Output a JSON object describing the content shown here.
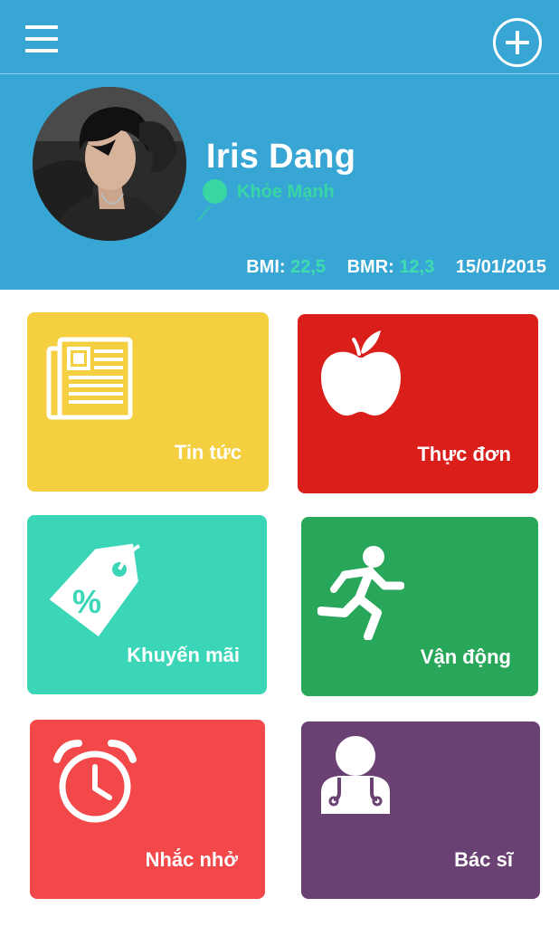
{
  "header": {
    "background_color": "#38a6d4",
    "menu_icon": "hamburger-menu-icon",
    "add_icon": "plus-circle-icon"
  },
  "profile": {
    "name": "Iris Dang",
    "status": "Khỏe Mạnh",
    "status_color": "#38d6a3",
    "avatar": "user-avatar-photo"
  },
  "stats": {
    "bmi_label": "BMI:",
    "bmi_value": "22,5",
    "bmr_label": "BMR:",
    "bmr_value": "12,3",
    "date": "15/01/2015",
    "value_color": "#3fdcae"
  },
  "tiles": [
    {
      "label": "Tin tức",
      "icon": "newspaper-icon",
      "color": "#f4cf3f"
    },
    {
      "label": "Thực đơn",
      "icon": "apple-icon",
      "color": "#da1f1b"
    },
    {
      "label": "Khuyến mãi",
      "icon": "discount-tag-icon",
      "color": "#3bd6b7"
    },
    {
      "label": "Vận động",
      "icon": "running-person-icon",
      "color": "#28a75a"
    },
    {
      "label": "Nhắc nhở",
      "icon": "alarm-clock-icon",
      "color": "#f34849"
    },
    {
      "label": "Bác sĩ",
      "icon": "doctor-icon",
      "color": "#6a4173"
    }
  ]
}
